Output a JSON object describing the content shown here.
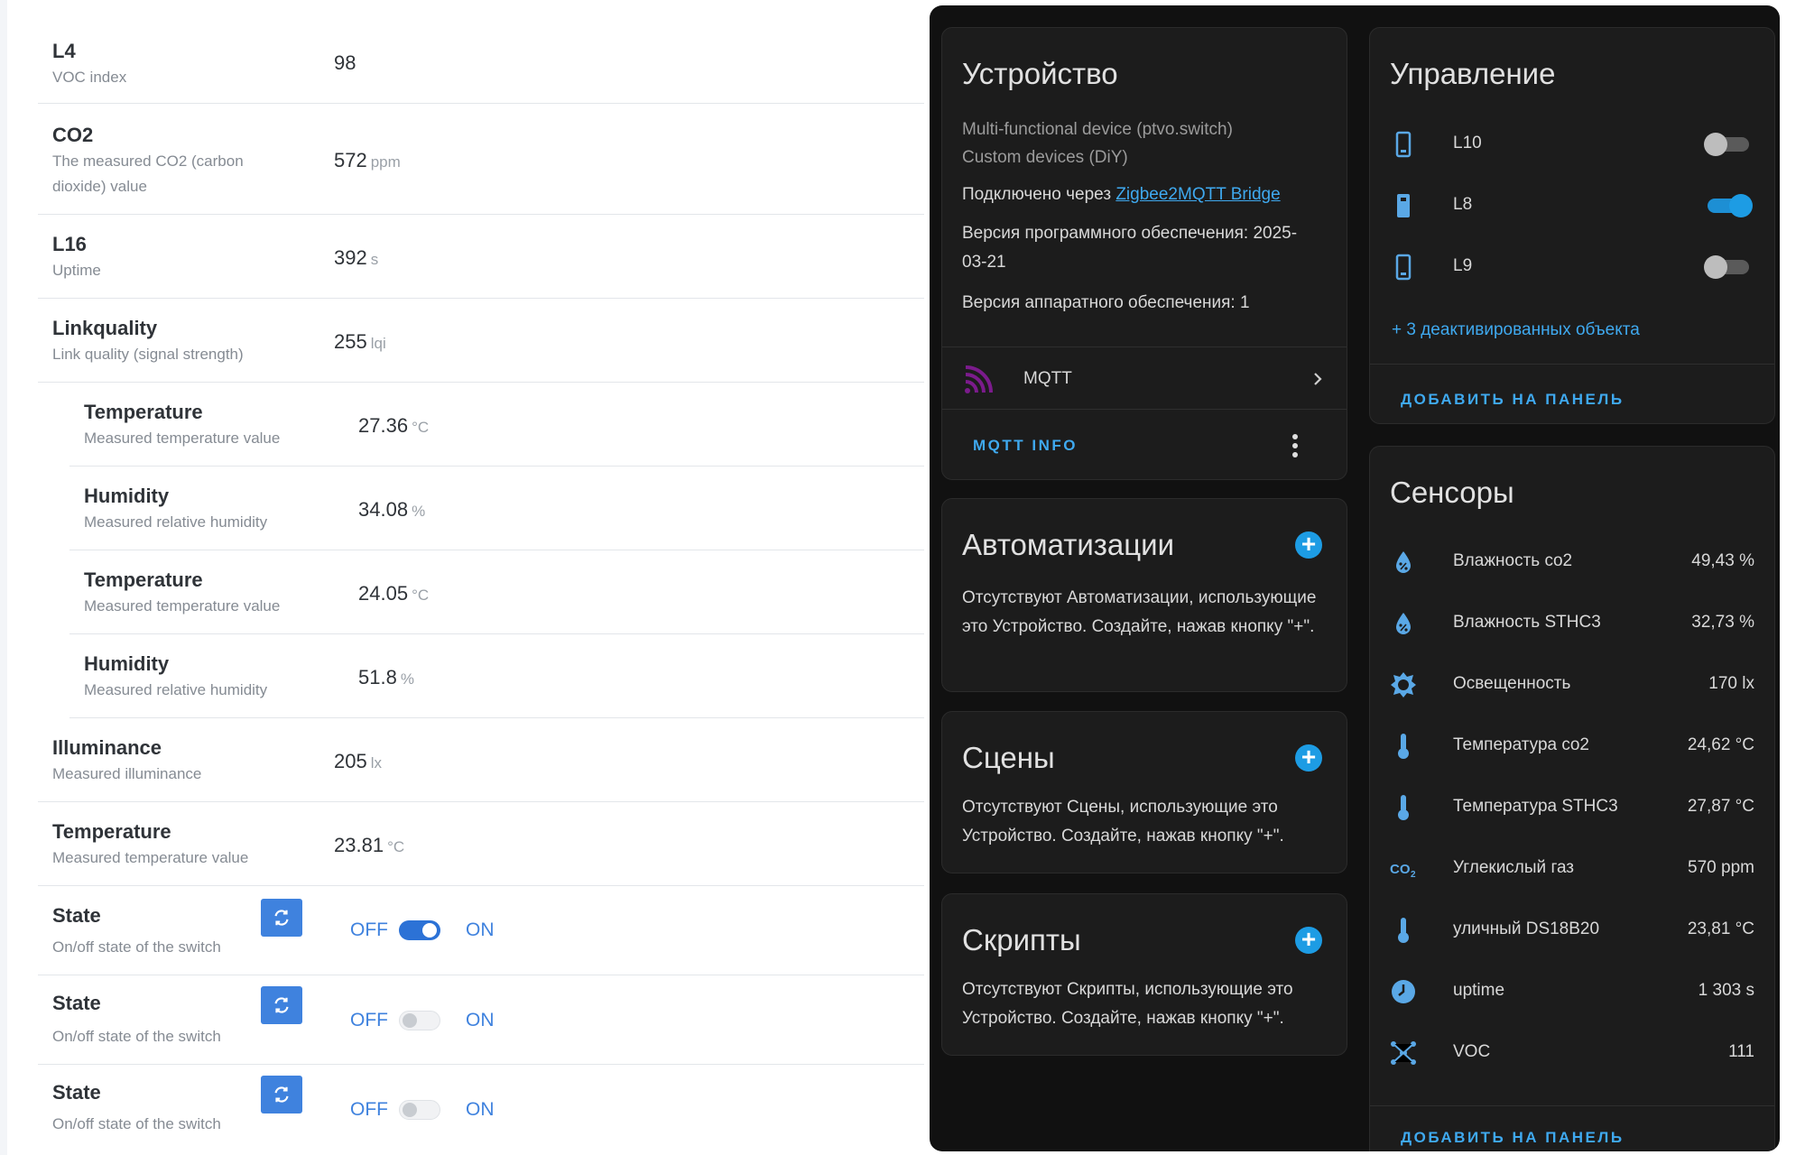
{
  "exposes": {
    "rows": [
      {
        "name": "L4",
        "desc": "VOC index",
        "value": "98",
        "unit": ""
      },
      {
        "name": "CO2",
        "desc": "The measured CO2 (carbon dioxide) value",
        "value": "572",
        "unit": "ppm"
      },
      {
        "name": "L16",
        "desc": "Uptime",
        "value": "392",
        "unit": "s"
      },
      {
        "name": "Linkquality",
        "desc": "Link quality (signal strength)",
        "value": "255",
        "unit": "lqi"
      },
      {
        "name": "Temperature",
        "desc": "Measured temperature value",
        "value": "27.36",
        "unit": "°C"
      },
      {
        "name": "Humidity",
        "desc": "Measured relative humidity",
        "value": "34.08",
        "unit": "%"
      },
      {
        "name": "Temperature",
        "desc": "Measured temperature value",
        "value": "24.05",
        "unit": "°C"
      },
      {
        "name": "Humidity",
        "desc": "Measured relative humidity",
        "value": "51.8",
        "unit": "%"
      },
      {
        "name": "Illuminance",
        "desc": "Measured illuminance",
        "value": "205",
        "unit": "lx"
      },
      {
        "name": "Temperature",
        "desc": "Measured temperature value",
        "value": "23.81",
        "unit": "°C"
      }
    ],
    "switches": [
      {
        "name": "State",
        "desc": "On/off state of the switch",
        "off_label": "OFF",
        "on_label": "ON",
        "state": "on"
      },
      {
        "name": "State",
        "desc": "On/off state of the switch",
        "off_label": "OFF",
        "on_label": "ON",
        "state": "off"
      },
      {
        "name": "State",
        "desc": "On/off state of the switch",
        "off_label": "OFF",
        "on_label": "ON",
        "state": "off"
      }
    ]
  },
  "device": {
    "title": "Устройство",
    "model": "Multi-functional device (ptvo.switch)",
    "manufacturer": "Custom devices (DiY)",
    "connected_prefix": "Подключено через",
    "connected_link": "Zigbee2MQTT Bridge",
    "firmware_line1": "Версия программного обеспечения: 2025-",
    "firmware_line2": "03-21",
    "hardware": "Версия аппаратного обеспечения: 1",
    "integration": "MQTT",
    "info_button": "MQTT INFO"
  },
  "automations": {
    "title": "Автоматизации",
    "text": "Отсутствуют Автоматизации, использующие это Устройство. Создайте, нажав кнопку \"+\"."
  },
  "scenes": {
    "title": "Сцены",
    "text": "Отсутствуют Сцены, использующие это Устройство. Создайте, нажав кнопку \"+\"."
  },
  "scripts": {
    "title": "Скрипты",
    "text": "Отсутствуют Скрипты, использующие это Устройство. Создайте, нажав кнопку \"+\"."
  },
  "controls": {
    "title": "Управление",
    "items": [
      {
        "name": "L10",
        "state": "off"
      },
      {
        "name": "L8",
        "state": "on"
      },
      {
        "name": "L9",
        "state": "off"
      }
    ],
    "disabled_link": "+ 3 деактивированных объекта",
    "add_button": "ДОБАВИТЬ НА ПАНЕЛЬ"
  },
  "sensors": {
    "title": "Сенсоры",
    "items": [
      {
        "name": "Влажность co2",
        "value": "49,43 %",
        "icon": "water-percent-icon"
      },
      {
        "name": "Влажность STHC3",
        "value": "32,73 %",
        "icon": "water-percent-icon"
      },
      {
        "name": "Освещенность",
        "value": "170 lx",
        "icon": "brightness-icon"
      },
      {
        "name": "Температура co2",
        "value": "24,62 °C",
        "icon": "thermometer-icon"
      },
      {
        "name": "Температура STHC3",
        "value": "27,87 °C",
        "icon": "thermometer-icon"
      },
      {
        "name": "Углекислый газ",
        "value": "570 ppm",
        "icon": "co2-icon"
      },
      {
        "name": "уличный DS18B20",
        "value": "23,81 °C",
        "icon": "thermometer-icon"
      },
      {
        "name": "uptime",
        "value": "1 303 s",
        "icon": "clock-icon"
      },
      {
        "name": "VOC",
        "value": "111",
        "icon": "molecule-icon"
      }
    ],
    "add_button": "ДОБАВИТЬ НА ПАНЕЛЬ"
  },
  "colors": {
    "accent_blue": "#3fa9ef",
    "z2m_blue": "#3f82de",
    "card_bg": "#1c1c1c",
    "mqtt_purple": "#7b1b8c"
  }
}
